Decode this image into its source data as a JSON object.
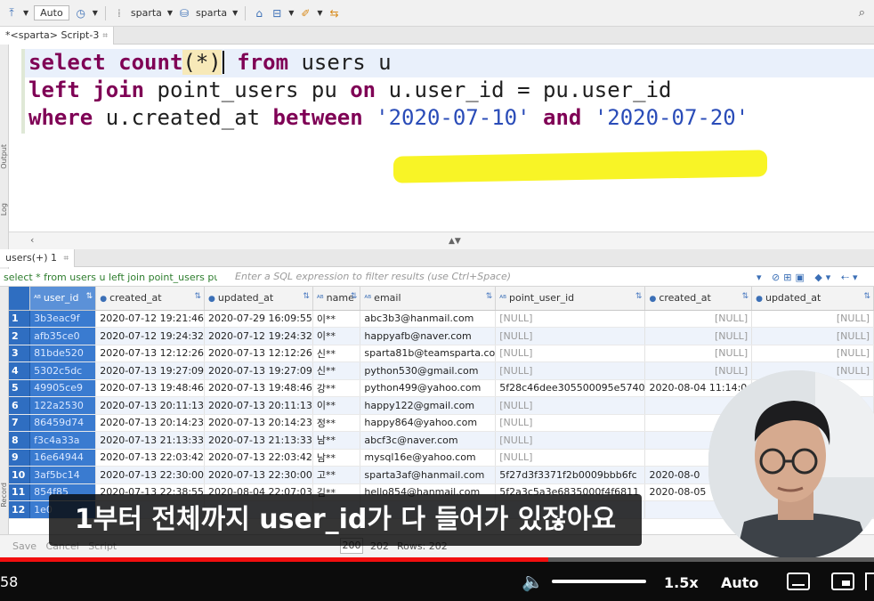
{
  "toolbar": {
    "auto_label": "Auto",
    "datasource_1": "sparta",
    "datasource_2": "sparta"
  },
  "script_tab": {
    "label": "*<sparta> Script-3"
  },
  "side_labels": [
    "Output",
    "Log",
    "Record"
  ],
  "editor": {
    "line1": {
      "kw1": "select",
      "fn": "count",
      "arg": "(*)",
      "kw2": "from",
      "rest": " users u"
    },
    "line2": {
      "kw1": "left join",
      "mid": " point_users pu ",
      "kw2": "on",
      "rest": " u.user_id = pu.user_id"
    },
    "line3": {
      "kw1": "where",
      "mid": " u.created_at ",
      "kw2": "between",
      "str1": "'2020-07-10'",
      "kw3": "and",
      "str2": "'2020-07-20'"
    }
  },
  "results_tab": {
    "label": "users(+) 1"
  },
  "filter": {
    "sql_text": "select * from users u left join point_users pu",
    "placeholder": "Enter a SQL expression to filter results (use Ctrl+Space)"
  },
  "grid": {
    "columns": [
      "user_id",
      "created_at",
      "updated_at",
      "name",
      "email",
      "point_user_id",
      "created_at",
      "updated_at"
    ],
    "rows": [
      [
        "1",
        "3b3eac9f",
        "2020-07-12 19:21:46",
        "2020-07-29 16:09:55",
        "이**",
        "abc3b3@hanmail.com",
        "[NULL]",
        "[NULL]",
        "[NULL]"
      ],
      [
        "2",
        "afb35ce0",
        "2020-07-12 19:24:32",
        "2020-07-12 19:24:32",
        "이**",
        "happyafb@naver.com",
        "[NULL]",
        "[NULL]",
        "[NULL]"
      ],
      [
        "3",
        "81bde520",
        "2020-07-13 12:12:26",
        "2020-07-13 12:12:26",
        "신**",
        "sparta81b@teamsparta.co",
        "[NULL]",
        "[NULL]",
        "[NULL]"
      ],
      [
        "4",
        "5302c5dc",
        "2020-07-13 19:27:09",
        "2020-07-13 19:27:09",
        "신**",
        "python530@gmail.com",
        "[NULL]",
        "[NULL]",
        "[NULL]"
      ],
      [
        "5",
        "49905ce9",
        "2020-07-13 19:48:46",
        "2020-07-13 19:48:46",
        "강**",
        "python499@yahoo.com",
        "5f28c46dee305500095e5740",
        "2020-08-04 11:14:0",
        ""
      ],
      [
        "6",
        "122a2530",
        "2020-07-13 20:11:13",
        "2020-07-13 20:11:13",
        "이**",
        "happy122@gmail.com",
        "[NULL]",
        "",
        ""
      ],
      [
        "7",
        "86459d74",
        "2020-07-13 20:14:23",
        "2020-07-13 20:14:23",
        "정**",
        "happy864@yahoo.com",
        "[NULL]",
        "",
        ""
      ],
      [
        "8",
        "f3c4a33a",
        "2020-07-13 21:13:33",
        "2020-07-13 21:13:33",
        "남**",
        "abcf3c@naver.com",
        "[NULL]",
        "",
        ""
      ],
      [
        "9",
        "16e64944",
        "2020-07-13 22:03:42",
        "2020-07-13 22:03:42",
        "남**",
        "mysql16e@yahoo.com",
        "[NULL]",
        "",
        ""
      ],
      [
        "10",
        "3af5bc14",
        "2020-07-13 22:30:00",
        "2020-07-13 22:30:00",
        "고**",
        "sparta3af@hanmail.com",
        "5f27d3f3371f2b0009bbb6fc",
        "2020-08-0",
        ""
      ],
      [
        "11",
        "854f85",
        "2020-07-13 22:38:55",
        "2020-08-04 22:07:03",
        "김**",
        "hello854@hanmail.com",
        "5f2a3c5a3e6835000f4f6811",
        "2020-08-05",
        ""
      ],
      [
        "12",
        "1e0",
        "",
        "",
        "",
        "",
        "",
        "",
        ""
      ]
    ]
  },
  "status": {
    "save": "Save",
    "cancel": "Cancel",
    "script": "Script",
    "fetch_size": "200",
    "count": "202",
    "rows": "Rows: 202"
  },
  "caption": "1부터 전체까지 user_id가 다 들어가 있잖아요",
  "player": {
    "time": "58",
    "speed": "1.5x",
    "quality": "Auto",
    "progress": 0.627
  }
}
